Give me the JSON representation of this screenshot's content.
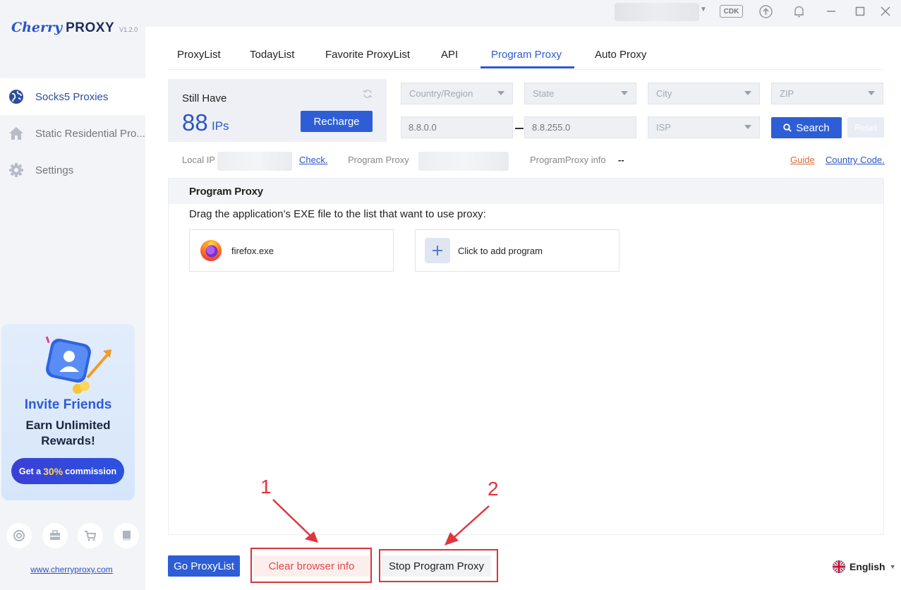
{
  "app": {
    "logo_cherry": "Cherry",
    "logo_proxy": "PROXY",
    "version": "V1.2.0"
  },
  "sidebar": {
    "items": [
      {
        "label": "Socks5 Proxies",
        "icon": "globe-icon",
        "active": true
      },
      {
        "label": "Static Residential Pro...",
        "icon": "home-icon",
        "active": false
      },
      {
        "label": "Settings",
        "icon": "gear-icon",
        "active": false
      }
    ],
    "promo": {
      "title": "Invite Friends",
      "line1": "Earn Unlimited",
      "line2": "Rewards!",
      "cta_prefix": "Get a",
      "cta_pct": "30%",
      "cta_suffix": "commission"
    },
    "bottom_icons": [
      "support-icon",
      "briefcase-icon",
      "cart-icon",
      "book-icon"
    ],
    "site_link": "www.cherryproxy.com"
  },
  "titlebar": {
    "cdk": "CDK",
    "icons": [
      "upload-icon",
      "bell-icon",
      "minimize-icon",
      "maximize-icon",
      "close-icon"
    ]
  },
  "tabs": [
    "ProxyList",
    "TodayList",
    "Favorite ProxyList",
    "API",
    "Program Proxy",
    "Auto Proxy"
  ],
  "active_tab": "Program Proxy",
  "balance": {
    "label": "Still Have",
    "count": "88",
    "unit": "IPs",
    "recharge": "Recharge"
  },
  "filters": {
    "country": "Country/Region",
    "state": "State",
    "city": "City",
    "zip": "ZIP",
    "ip_from": "8.8.0.0",
    "ip_to": "8.8.255.0",
    "isp": "ISP",
    "search": "Search",
    "reset": "Reset"
  },
  "info": {
    "local_ip_label": "Local IP",
    "check": "Check.",
    "program_proxy_label": "Program Proxy",
    "program_proxy_info_label": "ProgramProxy info",
    "program_proxy_info_value": "--",
    "guide": "Guide",
    "country_code": "Country Code."
  },
  "program_proxy": {
    "heading": "Program Proxy",
    "description": "Drag the application’s EXE file to the list that want to use proxy:",
    "programs": [
      {
        "name": "firefox.exe",
        "icon": "firefox-icon"
      }
    ],
    "add_label": "Click to add program"
  },
  "bottom": {
    "go_proxylist": "Go ProxyList",
    "clear_browser": "Clear browser info",
    "stop_proxy": "Stop Program Proxy"
  },
  "annotations": {
    "one": "1",
    "two": "2"
  },
  "language": "English",
  "colors": {
    "accent": "#2e5ed6",
    "annotation": "#d9333a",
    "sidebar_bg": "#f3f4f7"
  }
}
